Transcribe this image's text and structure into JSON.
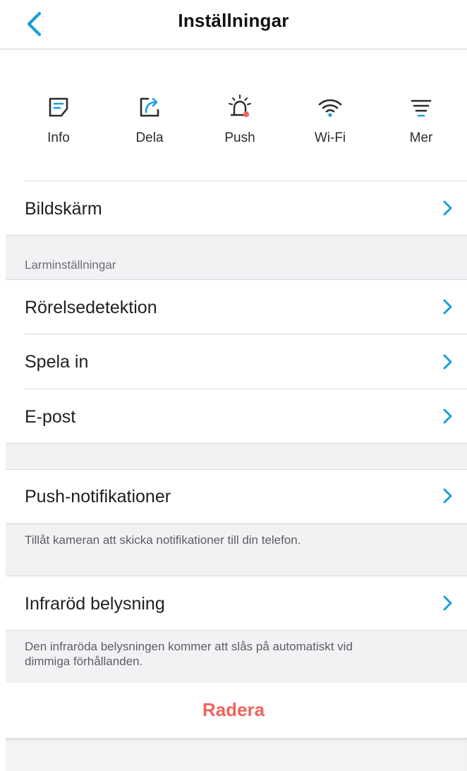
{
  "navbar": {
    "title": "Inställningar",
    "back_icon": "chevron-left-icon"
  },
  "quick_actions": [
    {
      "label": "Info",
      "icon": "info-note-icon"
    },
    {
      "label": "Dela",
      "icon": "share-icon"
    },
    {
      "label": "Push",
      "icon": "alarm-bell-icon"
    },
    {
      "label": "Wi-Fi",
      "icon": "wifi-icon"
    },
    {
      "label": "Mer",
      "icon": "more-lines-icon"
    }
  ],
  "rows": {
    "display": "Bildskärm",
    "motion_detection": "Rörelsedetektion",
    "record": "Spela in",
    "email": "E-post",
    "push_notifications": "Push-notifikationer",
    "infrared": "Infraröd belysning"
  },
  "sections": {
    "alarm_header": "Larminställningar"
  },
  "footnotes": {
    "push": "Tillåt kameran att skicka notifikationer till din telefon.",
    "infrared": "Den infraröda belysningen kommer att slås på automatiskt vid dimmiga förhållanden."
  },
  "delete_label": "Radera",
  "colors": {
    "accent": "#1a9fdc",
    "destructive": "#f2625e",
    "group_background": "#f2f2f4",
    "separator": "#d8d8dc"
  }
}
